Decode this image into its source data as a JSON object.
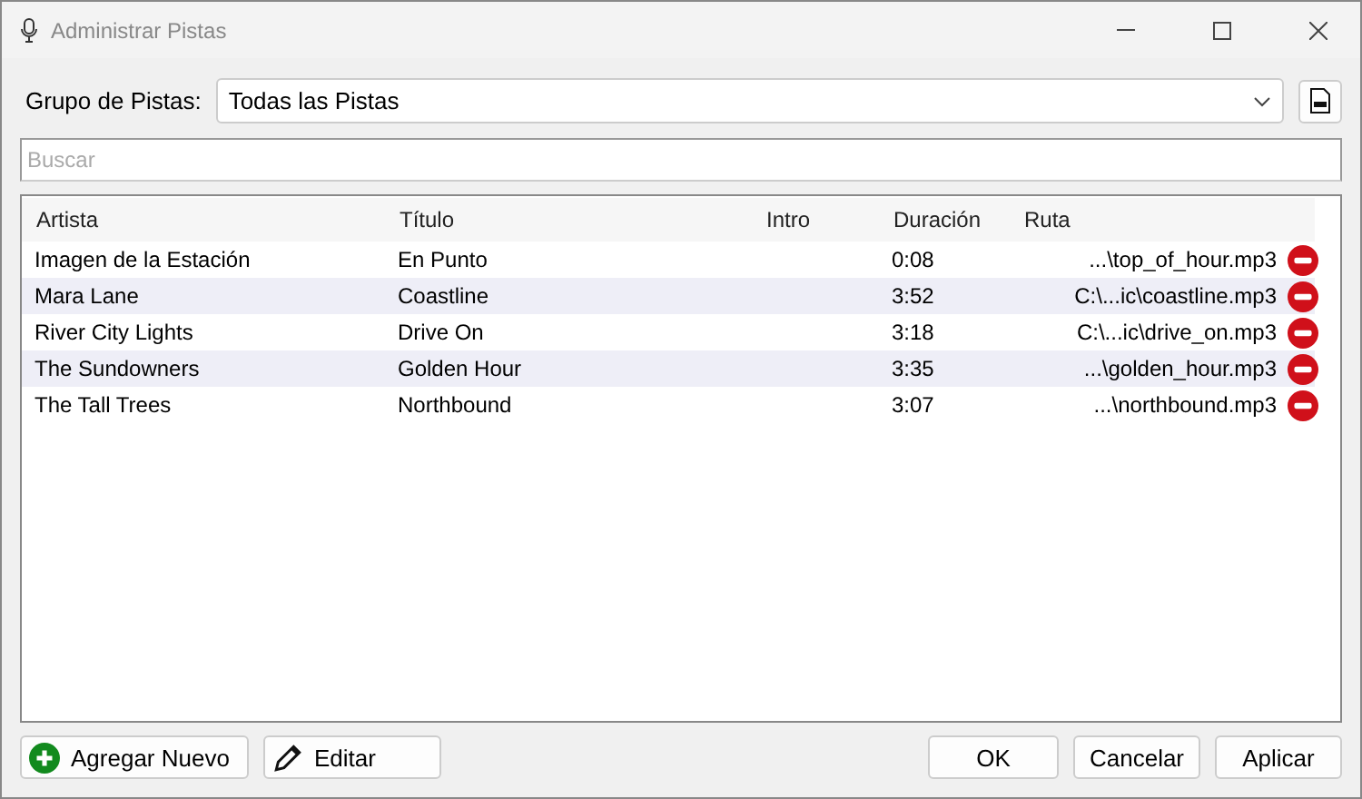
{
  "window": {
    "title": "Administrar Pistas"
  },
  "group": {
    "label": "Grupo de Pistas:",
    "value": "Todas las Pistas"
  },
  "search": {
    "placeholder": "Buscar"
  },
  "table": {
    "columns": [
      "Artista",
      "Título",
      "Intro",
      "Duración",
      "Ruta"
    ],
    "rows": [
      {
        "artist": "Imagen de la Estación",
        "title": "En Punto",
        "intro": "",
        "duration": "0:08",
        "path": "...\\top_of_hour.mp3"
      },
      {
        "artist": "Mara Lane",
        "title": "Coastline",
        "intro": "",
        "duration": "3:52",
        "path": "C:\\...ic\\coastline.mp3"
      },
      {
        "artist": "River City Lights",
        "title": "Drive On",
        "intro": "",
        "duration": "3:18",
        "path": "C:\\...ic\\drive_on.mp3"
      },
      {
        "artist": "The Sundowners",
        "title": "Golden Hour",
        "intro": "",
        "duration": "3:35",
        "path": "...\\golden_hour.mp3"
      },
      {
        "artist": "The Tall Trees",
        "title": "Northbound",
        "intro": "",
        "duration": "3:07",
        "path": "...\\northbound.mp3"
      }
    ]
  },
  "left_buttons": [
    {
      "kind": "add",
      "label": "Agregar Nuevo"
    },
    {
      "kind": "edit",
      "label": "Editar"
    }
  ],
  "right_buttons": [
    "OK",
    "Cancelar",
    "Aplicar"
  ]
}
